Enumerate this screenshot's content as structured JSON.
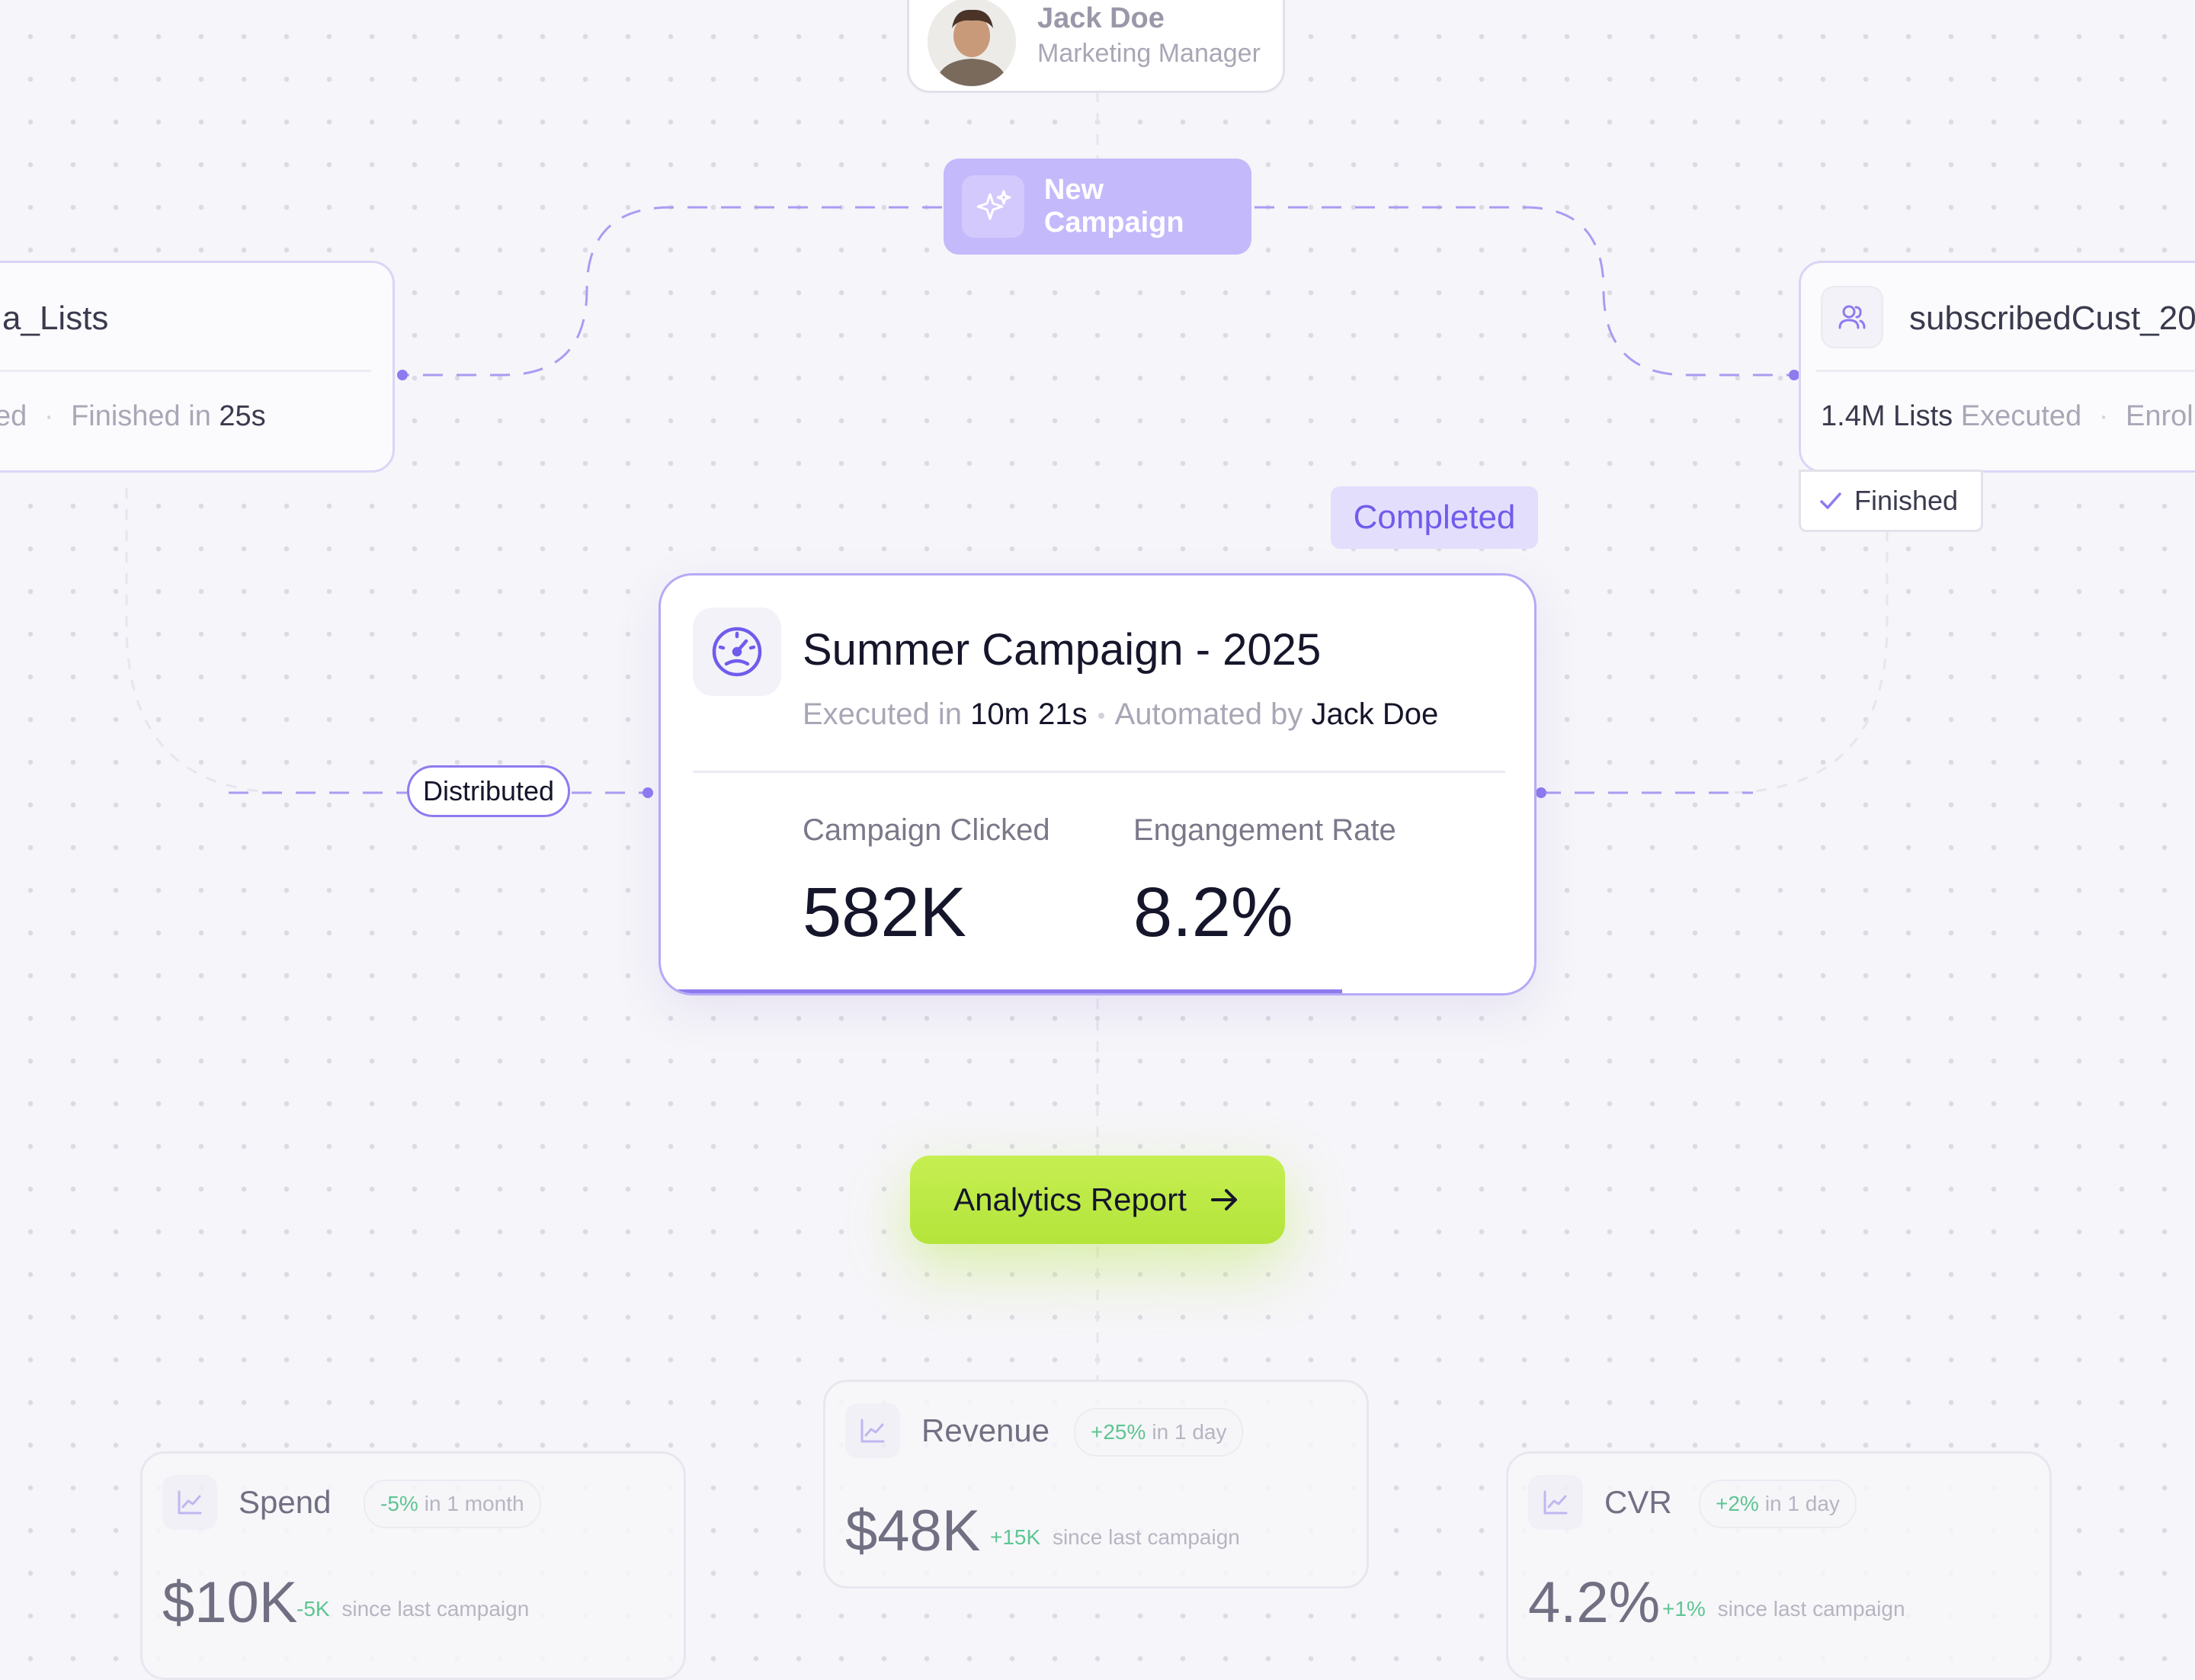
{
  "user": {
    "name": "Jack Doe",
    "role": "Marketing Manager",
    "avatar_icon": "avatar-photo"
  },
  "new_campaign": {
    "label": "New Campaign",
    "icon": "sparkle-icon"
  },
  "left_list": {
    "title": "a_Lists",
    "status_fragment": "ed",
    "finished_label": "Finished in",
    "finished_value": "25s"
  },
  "right_list": {
    "icon": "users-icon",
    "title": "subscribedCust_20",
    "count": "1.4M Lists",
    "executed_label": "Executed",
    "enroll_fragment": "Enroll",
    "finished_tag": "Finished"
  },
  "status_badge": "Completed",
  "campaign": {
    "icon": "gauge-icon",
    "title": "Summer Campaign - 2025",
    "executed_label": "Executed in",
    "executed_value": "10m 21s",
    "automated_label": "Automated by",
    "automated_value": "Jack Doe",
    "metrics": [
      {
        "label": "Campaign Clicked",
        "value": "582K"
      },
      {
        "label": "Engangement Rate",
        "value": "8.2%"
      }
    ],
    "progress": 0.78
  },
  "edge_label": "Distributed",
  "analytics": {
    "label": "Analytics Report",
    "icon": "arrow-right-icon"
  },
  "stats": [
    {
      "label": "Spend",
      "change": "-5%",
      "period": "in 1 month",
      "value": "$10K",
      "since_change": "-5K",
      "since_label": "since last campaign"
    },
    {
      "label": "Revenue",
      "change": "+25%",
      "period": "in 1 day",
      "value": "$48K",
      "since_change": "+15K",
      "since_label": "since last campaign"
    },
    {
      "label": "CVR",
      "change": "+2%",
      "period": "in 1 day",
      "value": "4.2%",
      "since_change": "+1%",
      "since_label": "since last campaign"
    }
  ],
  "colors": {
    "accent": "#8d7bf0",
    "accent_light": "#c4b9fb",
    "cta": "#bff04a",
    "positive": "#3dbb7c"
  }
}
